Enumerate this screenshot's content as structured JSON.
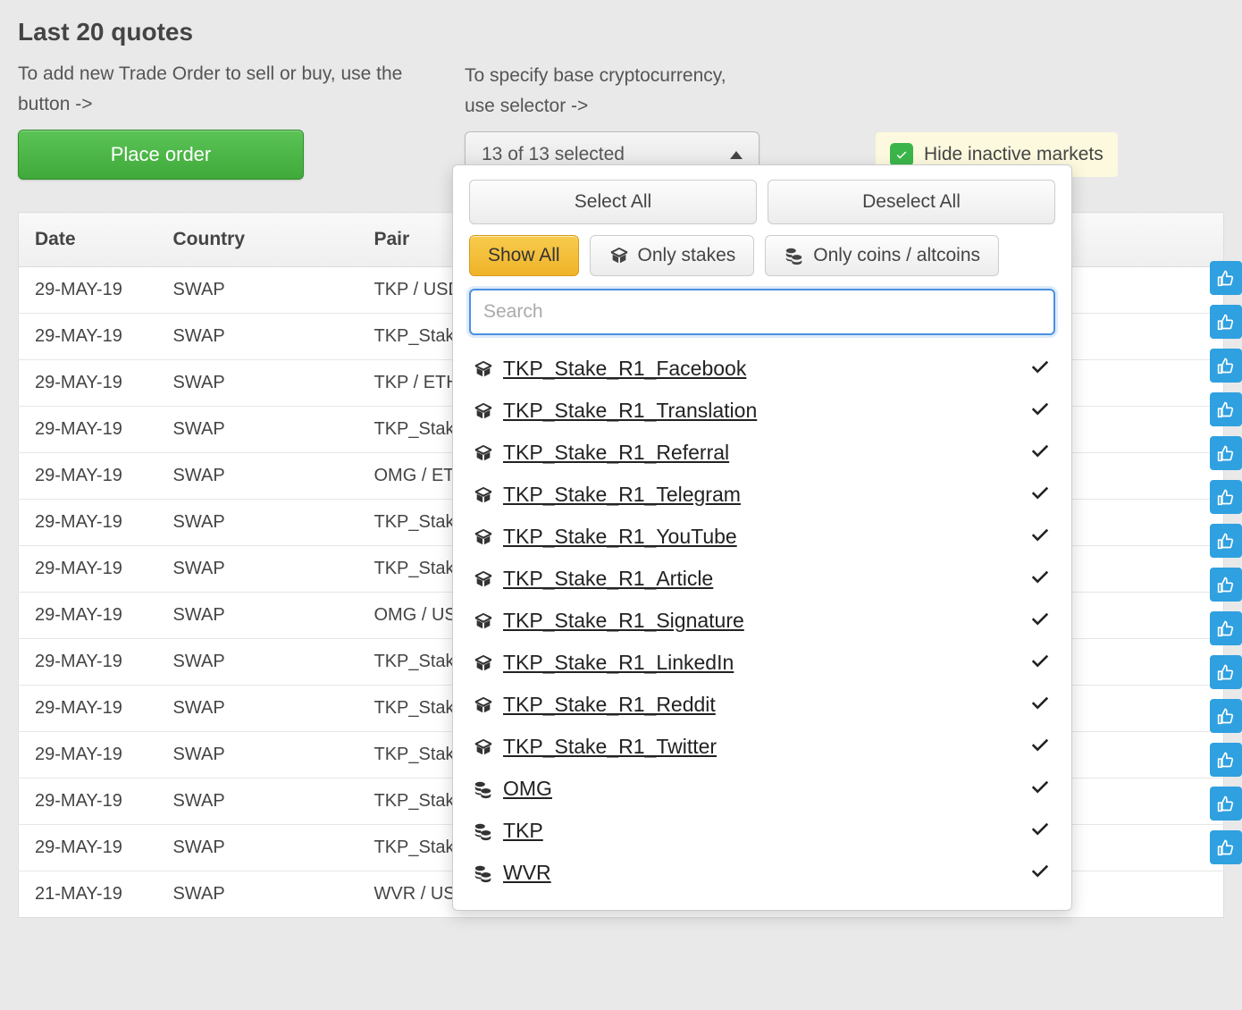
{
  "header": {
    "title": "Last 20 quotes",
    "left_instruction": "To add new Trade Order to sell or buy, use the button ->",
    "place_order_label": "Place order",
    "right_instruction_line1": "To specify base cryptocurrency,",
    "right_instruction_line2": "use selector ->",
    "selector_summary": "13 of 13 selected",
    "hide_inactive_label": "Hide inactive markets"
  },
  "dropdown": {
    "select_all": "Select All",
    "deselect_all": "Deselect All",
    "show_all": "Show All",
    "only_stakes": "Only stakes",
    "only_coins": "Only coins / altcoins",
    "search_placeholder": "Search",
    "items": [
      {
        "label": "TKP_Stake_R1_Facebook",
        "type": "stake",
        "checked": true
      },
      {
        "label": "TKP_Stake_R1_Translation",
        "type": "stake",
        "checked": true
      },
      {
        "label": "TKP_Stake_R1_Referral",
        "type": "stake",
        "checked": true
      },
      {
        "label": "TKP_Stake_R1_Telegram",
        "type": "stake",
        "checked": true
      },
      {
        "label": "TKP_Stake_R1_YouTube",
        "type": "stake",
        "checked": true
      },
      {
        "label": "TKP_Stake_R1_Article",
        "type": "stake",
        "checked": true
      },
      {
        "label": "TKP_Stake_R1_Signature",
        "type": "stake",
        "checked": true
      },
      {
        "label": "TKP_Stake_R1_LinkedIn",
        "type": "stake",
        "checked": true
      },
      {
        "label": "TKP_Stake_R1_Reddit",
        "type": "stake",
        "checked": true
      },
      {
        "label": "TKP_Stake_R1_Twitter",
        "type": "stake",
        "checked": true
      },
      {
        "label": "OMG",
        "type": "coin",
        "checked": true
      },
      {
        "label": "TKP",
        "type": "coin",
        "checked": true
      },
      {
        "label": "WVR",
        "type": "coin",
        "checked": true
      }
    ]
  },
  "table": {
    "columns": {
      "date": "Date",
      "country": "Country",
      "pair": "Pair"
    },
    "rows": [
      {
        "date": "29-MAY-19",
        "country": "SWAP",
        "pair": "TKP / USDC"
      },
      {
        "date": "29-MAY-19",
        "country": "SWAP",
        "pair": "TKP_Stake_"
      },
      {
        "date": "29-MAY-19",
        "country": "SWAP",
        "pair": "TKP / ETH"
      },
      {
        "date": "29-MAY-19",
        "country": "SWAP",
        "pair": "TKP_Stake_"
      },
      {
        "date": "29-MAY-19",
        "country": "SWAP",
        "pair": "OMG / ETH"
      },
      {
        "date": "29-MAY-19",
        "country": "SWAP",
        "pair": "TKP_Stake_"
      },
      {
        "date": "29-MAY-19",
        "country": "SWAP",
        "pair": "TKP_Stake_"
      },
      {
        "date": "29-MAY-19",
        "country": "SWAP",
        "pair": "OMG / USD"
      },
      {
        "date": "29-MAY-19",
        "country": "SWAP",
        "pair": "TKP_Stake_"
      },
      {
        "date": "29-MAY-19",
        "country": "SWAP",
        "pair": "TKP_Stake_"
      },
      {
        "date": "29-MAY-19",
        "country": "SWAP",
        "pair": "TKP_Stake_"
      },
      {
        "date": "29-MAY-19",
        "country": "SWAP",
        "pair": "TKP_Stake_"
      },
      {
        "date": "29-MAY-19",
        "country": "SWAP",
        "pair": "TKP_Stake_"
      },
      {
        "date": "21-MAY-19",
        "country": "SWAP",
        "pair": "WVR / USD"
      }
    ]
  }
}
